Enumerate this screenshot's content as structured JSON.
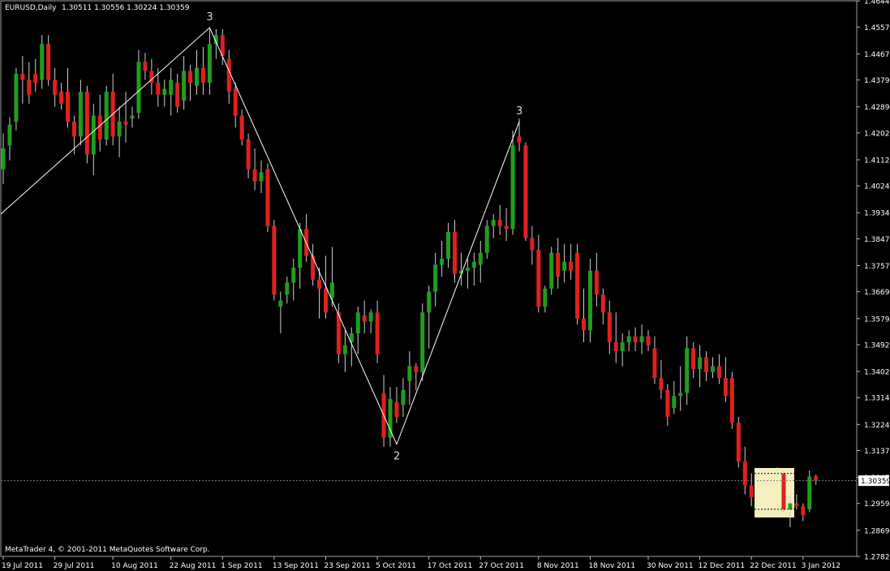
{
  "header": {
    "symbol": "EURUSD,Daily",
    "ohlc": "1.30511 1.30556 1.30224 1.30359"
  },
  "footer": {
    "copyright": "MetaTrader 4, © 2001-2011 MetaQuotes Software Corp."
  },
  "colors": {
    "background": "#000000",
    "bull": "#1f9e1f",
    "bear": "#e02020",
    "wick": "#cfcfcf",
    "axis": "#c0c0c0",
    "zigzag": "#ffffff",
    "highlight": "#f5efc0",
    "current_price_line": "#808080"
  },
  "chart_data": {
    "type": "candlestick",
    "title": "EURUSD,Daily",
    "y_axis_position": "right",
    "ylim": [
      1.2782,
      1.4645
    ],
    "yticks": [
      "1.46445",
      "1.45570",
      "1.44670",
      "1.43795",
      "1.42895",
      "1.42020",
      "1.41120",
      "1.40245",
      "1.39345",
      "1.38470",
      "1.37570",
      "1.36695",
      "1.35795",
      "1.34920",
      "1.34020",
      "1.33145",
      "1.32245",
      "1.31370",
      "1.30470",
      "1.29595",
      "1.28695",
      "1.27820"
    ],
    "current_price": "1.30359",
    "xticks": [
      {
        "label": "19 Jul 2011",
        "bar": 0
      },
      {
        "label": "29 Jul 2011",
        "bar": 8
      },
      {
        "label": "10 Aug 2011",
        "bar": 17
      },
      {
        "label": "22 Aug 2011",
        "bar": 26
      },
      {
        "label": "1 Sep 2011",
        "bar": 34
      },
      {
        "label": "13 Sep 2011",
        "bar": 42
      },
      {
        "label": "23 Sep 2011",
        "bar": 50
      },
      {
        "label": "5 Oct 2011",
        "bar": 58
      },
      {
        "label": "17 Oct 2011",
        "bar": 66
      },
      {
        "label": "27 Oct 2011",
        "bar": 74
      },
      {
        "label": "8 Nov 2011",
        "bar": 83
      },
      {
        "label": "18 Nov 2011",
        "bar": 91
      },
      {
        "label": "30 Nov 2011",
        "bar": 100
      },
      {
        "label": "12 Dec 2011",
        "bar": 108
      },
      {
        "label": "22 Dec 2011",
        "bar": 116
      },
      {
        "label": "3 Jan 2012",
        "bar": 124
      }
    ],
    "candles": [
      {
        "o": 1.408,
        "h": 1.42,
        "l": 1.403,
        "c": 1.415
      },
      {
        "o": 1.416,
        "h": 1.4255,
        "l": 1.411,
        "c": 1.423
      },
      {
        "o": 1.424,
        "h": 1.442,
        "l": 1.421,
        "c": 1.44
      },
      {
        "o": 1.44,
        "h": 1.446,
        "l": 1.43,
        "c": 1.438
      },
      {
        "o": 1.438,
        "h": 1.444,
        "l": 1.43,
        "c": 1.433
      },
      {
        "o": 1.44,
        "h": 1.445,
        "l": 1.434,
        "c": 1.437
      },
      {
        "o": 1.438,
        "h": 1.453,
        "l": 1.435,
        "c": 1.45
      },
      {
        "o": 1.45,
        "h": 1.453,
        "l": 1.436,
        "c": 1.438
      },
      {
        "o": 1.438,
        "h": 1.442,
        "l": 1.429,
        "c": 1.433
      },
      {
        "o": 1.434,
        "h": 1.437,
        "l": 1.428,
        "c": 1.43
      },
      {
        "o": 1.434,
        "h": 1.442,
        "l": 1.422,
        "c": 1.424
      },
      {
        "o": 1.424,
        "h": 1.426,
        "l": 1.413,
        "c": 1.419
      },
      {
        "o": 1.419,
        "h": 1.438,
        "l": 1.416,
        "c": 1.434
      },
      {
        "o": 1.434,
        "h": 1.436,
        "l": 1.41,
        "c": 1.413
      },
      {
        "o": 1.413,
        "h": 1.43,
        "l": 1.406,
        "c": 1.426
      },
      {
        "o": 1.426,
        "h": 1.433,
        "l": 1.414,
        "c": 1.418
      },
      {
        "o": 1.418,
        "h": 1.436,
        "l": 1.416,
        "c": 1.434
      },
      {
        "o": 1.434,
        "h": 1.44,
        "l": 1.416,
        "c": 1.419
      },
      {
        "o": 1.419,
        "h": 1.429,
        "l": 1.412,
        "c": 1.424
      },
      {
        "o": 1.424,
        "h": 1.434,
        "l": 1.417,
        "c": 1.423
      },
      {
        "o": 1.425,
        "h": 1.429,
        "l": 1.422,
        "c": 1.426
      },
      {
        "o": 1.427,
        "h": 1.448,
        "l": 1.425,
        "c": 1.444
      },
      {
        "o": 1.444,
        "h": 1.447,
        "l": 1.438,
        "c": 1.441
      },
      {
        "o": 1.441,
        "h": 1.445,
        "l": 1.433,
        "c": 1.437
      },
      {
        "o": 1.437,
        "h": 1.442,
        "l": 1.429,
        "c": 1.433
      },
      {
        "o": 1.433,
        "h": 1.438,
        "l": 1.429,
        "c": 1.435
      },
      {
        "o": 1.433,
        "h": 1.442,
        "l": 1.426,
        "c": 1.438
      },
      {
        "o": 1.437,
        "h": 1.44,
        "l": 1.427,
        "c": 1.429
      },
      {
        "o": 1.431,
        "h": 1.446,
        "l": 1.428,
        "c": 1.441
      },
      {
        "o": 1.441,
        "h": 1.443,
        "l": 1.431,
        "c": 1.437
      },
      {
        "o": 1.436,
        "h": 1.448,
        "l": 1.433,
        "c": 1.442
      },
      {
        "o": 1.442,
        "h": 1.449,
        "l": 1.433,
        "c": 1.437
      },
      {
        "o": 1.437,
        "h": 1.455,
        "l": 1.433,
        "c": 1.45
      },
      {
        "o": 1.45,
        "h": 1.455,
        "l": 1.445,
        "c": 1.453
      },
      {
        "o": 1.453,
        "h": 1.455,
        "l": 1.443,
        "c": 1.446
      },
      {
        "o": 1.445,
        "h": 1.448,
        "l": 1.43,
        "c": 1.434
      },
      {
        "o": 1.435,
        "h": 1.437,
        "l": 1.422,
        "c": 1.426
      },
      {
        "o": 1.426,
        "h": 1.428,
        "l": 1.416,
        "c": 1.418
      },
      {
        "o": 1.418,
        "h": 1.42,
        "l": 1.405,
        "c": 1.408
      },
      {
        "o": 1.408,
        "h": 1.415,
        "l": 1.401,
        "c": 1.404
      },
      {
        "o": 1.404,
        "h": 1.411,
        "l": 1.4,
        "c": 1.407
      },
      {
        "o": 1.408,
        "h": 1.41,
        "l": 1.387,
        "c": 1.389
      },
      {
        "o": 1.389,
        "h": 1.391,
        "l": 1.364,
        "c": 1.366
      },
      {
        "o": 1.362,
        "h": 1.367,
        "l": 1.353,
        "c": 1.364
      },
      {
        "o": 1.366,
        "h": 1.372,
        "l": 1.363,
        "c": 1.37
      },
      {
        "o": 1.37,
        "h": 1.378,
        "l": 1.364,
        "c": 1.375
      },
      {
        "o": 1.375,
        "h": 1.39,
        "l": 1.368,
        "c": 1.388
      },
      {
        "o": 1.388,
        "h": 1.393,
        "l": 1.377,
        "c": 1.379
      },
      {
        "o": 1.379,
        "h": 1.383,
        "l": 1.369,
        "c": 1.371
      },
      {
        "o": 1.371,
        "h": 1.375,
        "l": 1.358,
        "c": 1.368
      },
      {
        "o": 1.368,
        "h": 1.379,
        "l": 1.358,
        "c": 1.36
      },
      {
        "o": 1.365,
        "h": 1.382,
        "l": 1.362,
        "c": 1.37
      },
      {
        "o": 1.36,
        "h": 1.363,
        "l": 1.343,
        "c": 1.346
      },
      {
        "o": 1.346,
        "h": 1.354,
        "l": 1.34,
        "c": 1.349
      },
      {
        "o": 1.35,
        "h": 1.355,
        "l": 1.342,
        "c": 1.353
      },
      {
        "o": 1.353,
        "h": 1.362,
        "l": 1.346,
        "c": 1.36
      },
      {
        "o": 1.359,
        "h": 1.364,
        "l": 1.353,
        "c": 1.357
      },
      {
        "o": 1.357,
        "h": 1.361,
        "l": 1.353,
        "c": 1.36
      },
      {
        "o": 1.36,
        "h": 1.364,
        "l": 1.343,
        "c": 1.346
      },
      {
        "o": 1.333,
        "h": 1.339,
        "l": 1.315,
        "c": 1.318
      },
      {
        "o": 1.318,
        "h": 1.335,
        "l": 1.315,
        "c": 1.331
      },
      {
        "o": 1.33,
        "h": 1.335,
        "l": 1.323,
        "c": 1.325
      },
      {
        "o": 1.329,
        "h": 1.338,
        "l": 1.325,
        "c": 1.334
      },
      {
        "o": 1.337,
        "h": 1.347,
        "l": 1.329,
        "c": 1.342
      },
      {
        "o": 1.342,
        "h": 1.343,
        "l": 1.334,
        "c": 1.34
      },
      {
        "o": 1.34,
        "h": 1.363,
        "l": 1.337,
        "c": 1.36
      },
      {
        "o": 1.36,
        "h": 1.369,
        "l": 1.348,
        "c": 1.367
      },
      {
        "o": 1.367,
        "h": 1.38,
        "l": 1.362,
        "c": 1.376
      },
      {
        "o": 1.376,
        "h": 1.384,
        "l": 1.372,
        "c": 1.378
      },
      {
        "o": 1.378,
        "h": 1.39,
        "l": 1.375,
        "c": 1.387
      },
      {
        "o": 1.387,
        "h": 1.391,
        "l": 1.37,
        "c": 1.373
      },
      {
        "o": 1.373,
        "h": 1.38,
        "l": 1.369,
        "c": 1.374
      },
      {
        "o": 1.374,
        "h": 1.378,
        "l": 1.368,
        "c": 1.375
      },
      {
        "o": 1.375,
        "h": 1.38,
        "l": 1.369,
        "c": 1.377
      },
      {
        "o": 1.376,
        "h": 1.384,
        "l": 1.37,
        "c": 1.38
      },
      {
        "o": 1.38,
        "h": 1.391,
        "l": 1.378,
        "c": 1.389
      },
      {
        "o": 1.389,
        "h": 1.393,
        "l": 1.385,
        "c": 1.391
      },
      {
        "o": 1.391,
        "h": 1.396,
        "l": 1.386,
        "c": 1.389
      },
      {
        "o": 1.389,
        "h": 1.395,
        "l": 1.384,
        "c": 1.388
      },
      {
        "o": 1.388,
        "h": 1.421,
        "l": 1.386,
        "c": 1.416
      },
      {
        "o": 1.419,
        "h": 1.425,
        "l": 1.414,
        "c": 1.417
      },
      {
        "o": 1.416,
        "h": 1.417,
        "l": 1.384,
        "c": 1.385
      },
      {
        "o": 1.385,
        "h": 1.389,
        "l": 1.376,
        "c": 1.381
      },
      {
        "o": 1.381,
        "h": 1.386,
        "l": 1.36,
        "c": 1.362
      },
      {
        "o": 1.362,
        "h": 1.369,
        "l": 1.36,
        "c": 1.368
      },
      {
        "o": 1.368,
        "h": 1.382,
        "l": 1.366,
        "c": 1.38
      },
      {
        "o": 1.38,
        "h": 1.385,
        "l": 1.368,
        "c": 1.372
      },
      {
        "o": 1.374,
        "h": 1.383,
        "l": 1.37,
        "c": 1.377
      },
      {
        "o": 1.377,
        "h": 1.383,
        "l": 1.371,
        "c": 1.374
      },
      {
        "o": 1.38,
        "h": 1.383,
        "l": 1.356,
        "c": 1.358
      },
      {
        "o": 1.358,
        "h": 1.368,
        "l": 1.35,
        "c": 1.354
      },
      {
        "o": 1.354,
        "h": 1.378,
        "l": 1.35,
        "c": 1.374
      },
      {
        "o": 1.374,
        "h": 1.38,
        "l": 1.362,
        "c": 1.366
      },
      {
        "o": 1.366,
        "h": 1.368,
        "l": 1.356,
        "c": 1.36
      },
      {
        "o": 1.36,
        "h": 1.364,
        "l": 1.346,
        "c": 1.35
      },
      {
        "o": 1.35,
        "h": 1.36,
        "l": 1.343,
        "c": 1.347
      },
      {
        "o": 1.347,
        "h": 1.353,
        "l": 1.342,
        "c": 1.35
      },
      {
        "o": 1.35,
        "h": 1.354,
        "l": 1.347,
        "c": 1.352
      },
      {
        "o": 1.352,
        "h": 1.355,
        "l": 1.347,
        "c": 1.35
      },
      {
        "o": 1.35,
        "h": 1.356,
        "l": 1.346,
        "c": 1.352
      },
      {
        "o": 1.352,
        "h": 1.354,
        "l": 1.347,
        "c": 1.349
      },
      {
        "o": 1.348,
        "h": 1.352,
        "l": 1.336,
        "c": 1.338
      },
      {
        "o": 1.338,
        "h": 1.344,
        "l": 1.331,
        "c": 1.334
      },
      {
        "o": 1.334,
        "h": 1.336,
        "l": 1.322,
        "c": 1.325
      },
      {
        "o": 1.328,
        "h": 1.337,
        "l": 1.326,
        "c": 1.332
      },
      {
        "o": 1.332,
        "h": 1.342,
        "l": 1.327,
        "c": 1.333
      },
      {
        "o": 1.333,
        "h": 1.352,
        "l": 1.329,
        "c": 1.348
      },
      {
        "o": 1.348,
        "h": 1.35,
        "l": 1.338,
        "c": 1.341
      },
      {
        "o": 1.341,
        "h": 1.349,
        "l": 1.335,
        "c": 1.345
      },
      {
        "o": 1.345,
        "h": 1.347,
        "l": 1.337,
        "c": 1.34
      },
      {
        "o": 1.34,
        "h": 1.345,
        "l": 1.338,
        "c": 1.342
      },
      {
        "o": 1.342,
        "h": 1.346,
        "l": 1.336,
        "c": 1.338
      },
      {
        "o": 1.338,
        "h": 1.345,
        "l": 1.33,
        "c": 1.332
      },
      {
        "o": 1.338,
        "h": 1.34,
        "l": 1.321,
        "c": 1.323
      },
      {
        "o": 1.323,
        "h": 1.325,
        "l": 1.308,
        "c": 1.31
      },
      {
        "o": 1.31,
        "h": 1.315,
        "l": 1.299,
        "c": 1.302
      },
      {
        "o": 1.302,
        "h": 1.306,
        "l": 1.295,
        "c": 1.298
      },
      {
        "o": 1.298,
        "h": 1.302,
        "l": 1.296,
        "c": 1.301
      },
      {
        "o": 1.302,
        "h": 1.306,
        "l": 1.298,
        "c": 1.299
      },
      {
        "o": 1.299,
        "h": 1.304,
        "l": 1.297,
        "c": 1.302
      },
      {
        "o": 1.301,
        "h": 1.308,
        "l": 1.299,
        "c": 1.306
      }
    ],
    "highlight_candles": [
      {
        "o": 1.306,
        "h": 1.307,
        "l": 1.293,
        "c": 1.294
      },
      {
        "o": 1.294,
        "h": 1.299,
        "l": 1.288,
        "c": 1.296
      },
      {
        "o": 1.296,
        "h": 1.299,
        "l": 1.294,
        "c": 1.295
      },
      {
        "o": 1.295,
        "h": 1.296,
        "l": 1.29,
        "c": 1.292
      },
      {
        "o": 1.294,
        "h": 1.307,
        "l": 1.293,
        "c": 1.305
      },
      {
        "o": 1.3051,
        "h": 1.3056,
        "l": 1.3022,
        "c": 1.3036
      }
    ],
    "zigzag": [
      {
        "bar": -1,
        "price": 1.393,
        "label": ""
      },
      {
        "bar": 32,
        "price": 1.4555,
        "label": "3"
      },
      {
        "bar": 61,
        "price": 1.3158,
        "label": "2"
      },
      {
        "bar": 80,
        "price": 1.424,
        "label": "3"
      }
    ]
  }
}
